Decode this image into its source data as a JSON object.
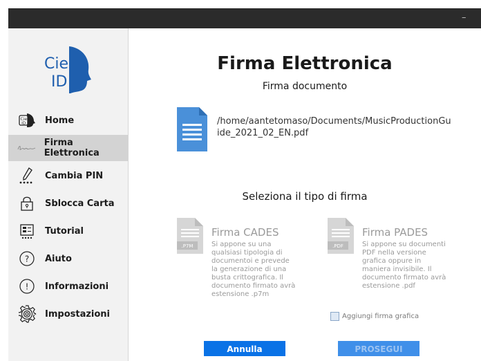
{
  "window": {
    "minimize_symbol": "–",
    "close_symbol": "✕"
  },
  "logo": {
    "line1": "Cie",
    "line2": "ID"
  },
  "sidebar": {
    "items": [
      {
        "label": "Home",
        "icon": "cie-id-icon"
      },
      {
        "label": "Firma Elettronica",
        "icon": "signature-icon",
        "active": true
      },
      {
        "label": "Cambia PIN",
        "icon": "pen-pin-icon"
      },
      {
        "label": "Sblocca Carta",
        "icon": "lock-icon"
      },
      {
        "label": "Tutorial",
        "icon": "tutorial-icon"
      },
      {
        "label": "Aiuto",
        "icon": "question-icon"
      },
      {
        "label": "Informazioni",
        "icon": "info-icon"
      },
      {
        "label": "Impostazioni",
        "icon": "gear-icon"
      }
    ]
  },
  "main": {
    "title": "Firma Elettronica",
    "subtitle": "Firma documento",
    "document_path": "/home/aantetomaso/Documents/MusicProductionGuide_2021_02_EN.pdf",
    "section_title": "Seleziona il tipo di firma",
    "options": [
      {
        "title": "Firma CADES",
        "badge": ".P7M",
        "description": "Si appone su una qualsiasi tipologia di documentoi e prevede la generazione di una busta crittografica. Il documento firmato avrà estensione .p7m"
      },
      {
        "title": "Firma PADES",
        "badge": ".PDF",
        "description": "Si appone su documenti PDF nella versione grafica oppure in maniera invisibile. Il documento firmato avrà estensione .pdf"
      }
    ],
    "checkbox_label": "Aggiungi firma grafica",
    "cancel_label": "Annulla",
    "proceed_label": "PROSEGUI"
  },
  "colors": {
    "accent": "#0a72e6",
    "doc_icon": "#4a90d9",
    "sidebar_bg": "#f2f2f2",
    "active_bg": "#d3d3d3"
  }
}
